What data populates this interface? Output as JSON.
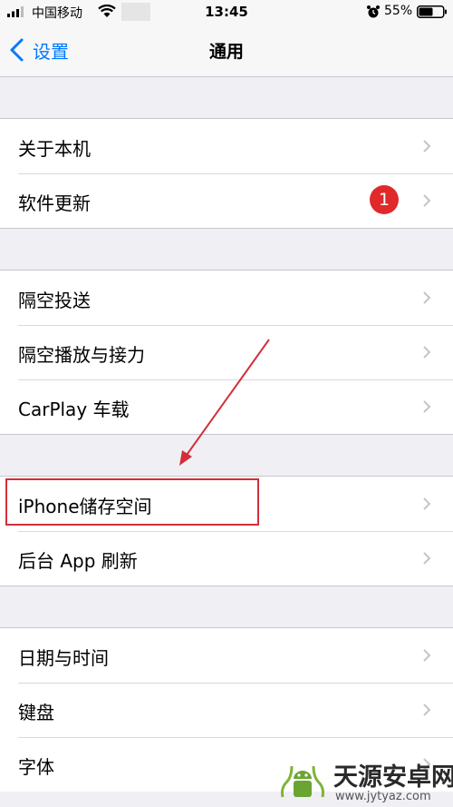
{
  "status_bar": {
    "carrier": "中国移动",
    "time": "13:45",
    "battery": "55%"
  },
  "nav": {
    "back_label": "设置",
    "title": "通用"
  },
  "groups": [
    {
      "items": [
        {
          "label": "关于本机"
        },
        {
          "label": "软件更新",
          "badge": "1"
        }
      ]
    },
    {
      "items": [
        {
          "label": "隔空投送"
        },
        {
          "label": "隔空播放与接力"
        },
        {
          "label": "CarPlay 车载"
        }
      ]
    },
    {
      "items": [
        {
          "label": "iPhone储存空间"
        },
        {
          "label": "后台 App 刷新"
        }
      ]
    },
    {
      "items": [
        {
          "label": "日期与时间"
        },
        {
          "label": "键盘"
        },
        {
          "label": "字体"
        }
      ]
    }
  ],
  "colors": {
    "accent": "#007aff",
    "badge": "#e02a2a",
    "annotation": "#d32f3a",
    "background": "#efeff4"
  },
  "watermark": {
    "brand": "天源安卓网",
    "url": "www.jytyaz.com"
  }
}
